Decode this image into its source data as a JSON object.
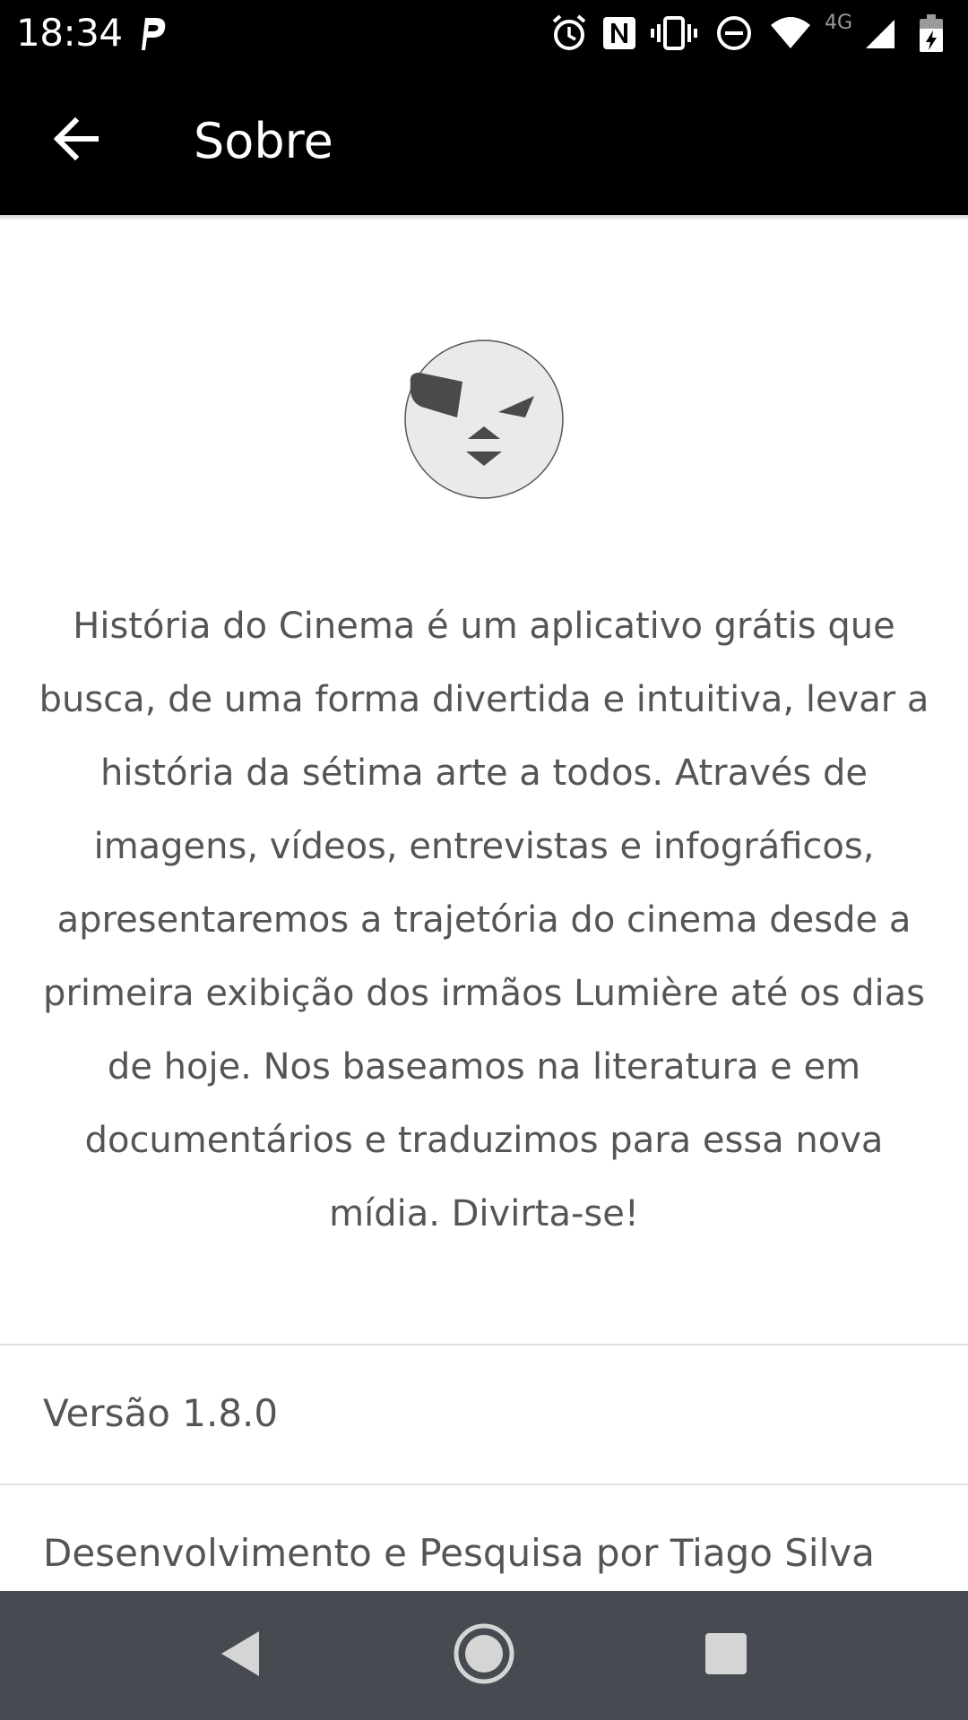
{
  "status_bar": {
    "time": "18:34",
    "network_label": "4G",
    "icons": [
      "parking-icon",
      "alarm-icon",
      "nfc-icon",
      "vibrate-icon",
      "do-not-disturb-icon",
      "wifi-icon",
      "signal-icon",
      "battery-charging-icon"
    ]
  },
  "app_bar": {
    "back_icon": "arrow-back-icon",
    "title": "Sobre"
  },
  "logo": {
    "icon": "winking-face-logo-icon"
  },
  "about": {
    "description": "História do Cinema é um aplicativo grátis que busca, de uma forma divertida e intuitiva, levar a história da sétima arte a todos. Através de imagens, vídeos, entrevistas e infográficos, apresentaremos a trajetória do cinema desde a primeira exibição dos irmãos Lumière até os dias de hoje. Nos baseamos na literatura e em documentários e traduzimos para essa nova mídia. Divirta-se!",
    "version": "Versão 1.8.0",
    "credits": "Desenvolvimento e Pesquisa por Tiago Silva"
  },
  "nav_bar": {
    "back_icon": "nav-back-icon",
    "home_icon": "nav-home-icon",
    "recents_icon": "nav-recents-icon"
  },
  "colors": {
    "app_bar": "#000000",
    "text": "#555555",
    "nav_bar": "#454b50",
    "logo_fill": "#eaeaea",
    "logo_features": "#4a4a4a"
  }
}
